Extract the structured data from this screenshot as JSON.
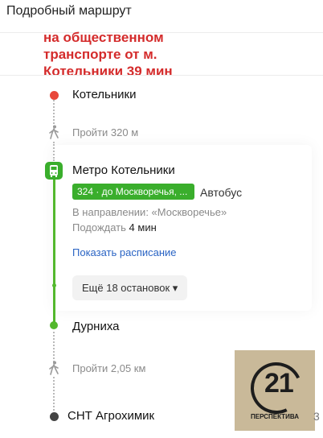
{
  "header": {
    "title": "Подробный маршрут"
  },
  "annotation": {
    "line1": "на общественном",
    "line2": "транспорте от м.",
    "line3": "Котельники  39 мин",
    "color": "#d42b2b"
  },
  "route": {
    "start_stop": "Котельники",
    "walk1": "Пройти 320 м",
    "board_stop": "Метро Котельники",
    "route_chip": "324 · до Москворечья, ...",
    "vehicle_type": "Автобус",
    "direction": "В направлении: «Москворечье»",
    "wait_label": "Подождать",
    "wait_value": "4 мин",
    "schedule_link": "Показать расписание",
    "more_stops": "Ещё 18 остановок ▾",
    "exit_stop": "Дурниха",
    "walk2": "Пройти 2,05 км",
    "end_stop": "СНТ Агрохимик"
  },
  "logo": {
    "number": "21",
    "caption": "ПЕРСПЕКТИВА"
  },
  "edge_digit": "3",
  "colors": {
    "start_dot": "#e8473a",
    "transit_green": "#3aae2c",
    "link_blue": "#2a64c4",
    "end_dot": "#444444"
  }
}
